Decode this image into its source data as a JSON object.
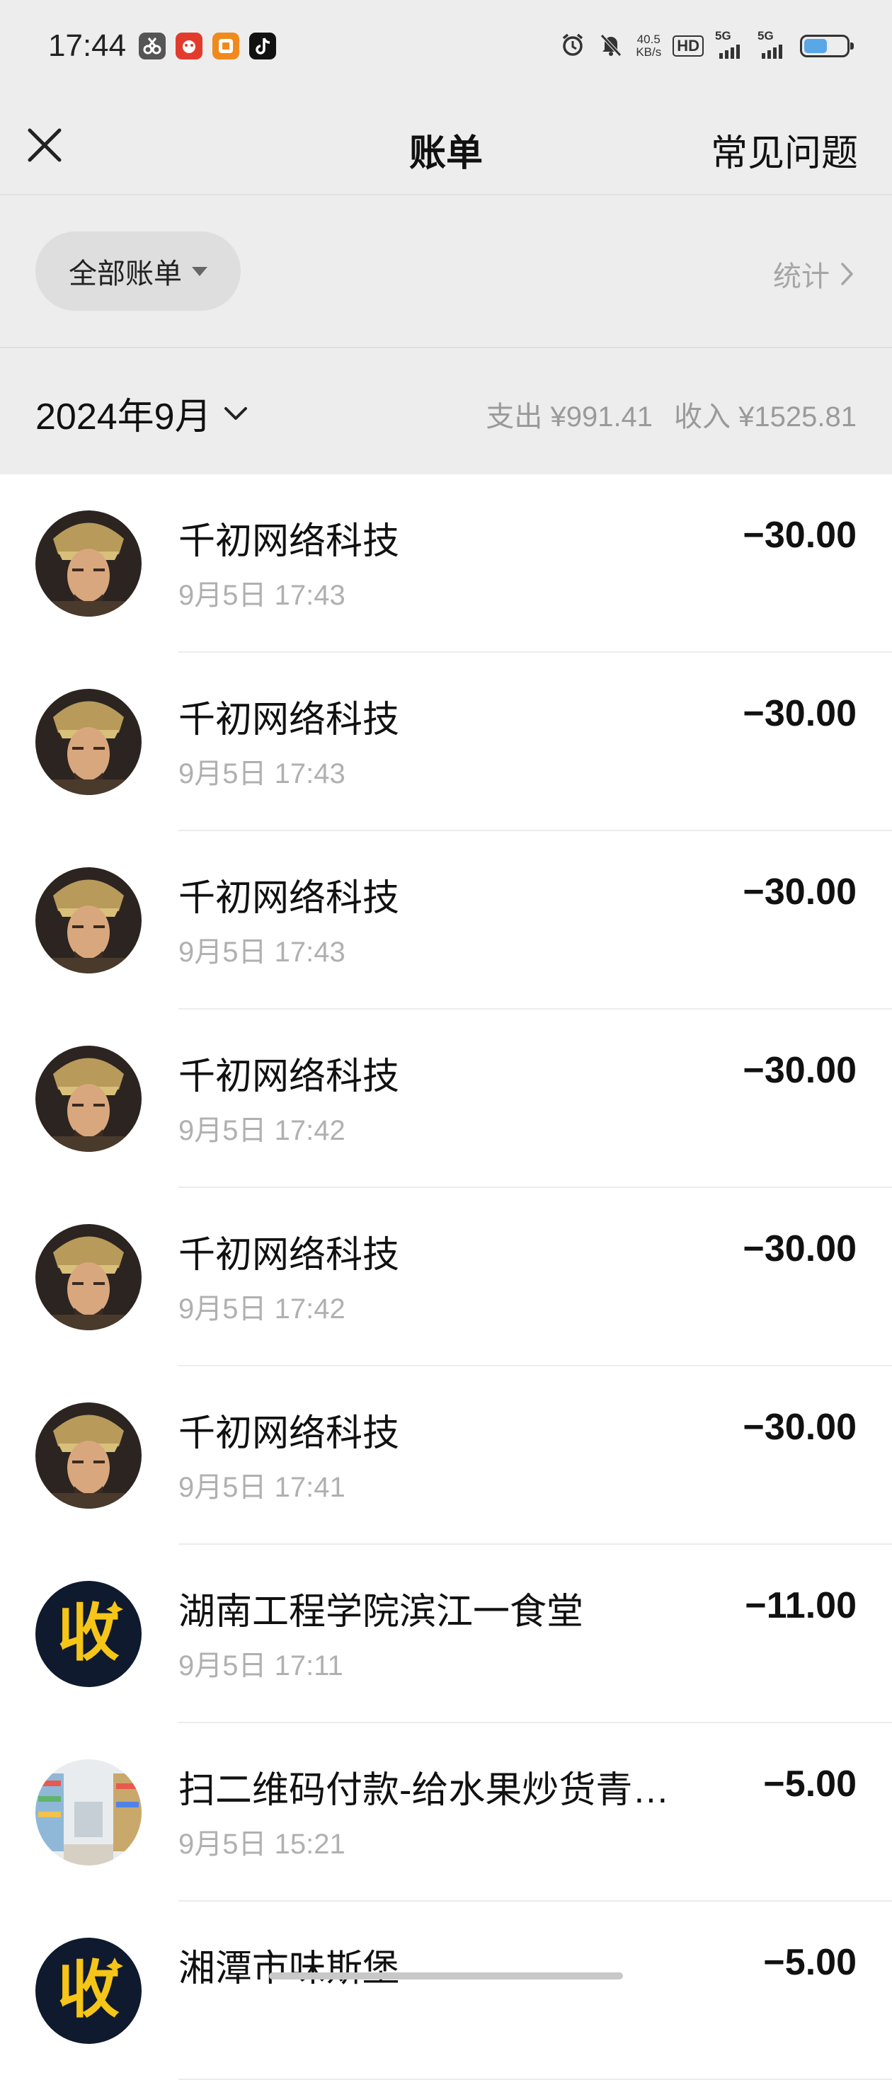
{
  "status_bar": {
    "time": "17:44",
    "net_speed_value": "40.5",
    "net_speed_unit": "KB/s",
    "hd_label": "HD",
    "signal1_label": "5G",
    "signal2_label": "5G",
    "battery_level": 0.55,
    "app_icons": [
      "scissors-app-icon",
      "red-app-icon",
      "orange-app-icon",
      "tiktok-icon"
    ]
  },
  "nav": {
    "title": "账单",
    "faq_label": "常见问题"
  },
  "filter": {
    "label": "全部账单",
    "stats_label": "统计"
  },
  "month": {
    "label": "2024年9月",
    "expense": "支出 ¥991.41",
    "income": "收入 ¥1525.81"
  },
  "transactions": [
    {
      "merchant": "千初网络科技",
      "time": "9月5日 17:43",
      "amount": "−30.00",
      "avatar": "portrait-avatar"
    },
    {
      "merchant": "千初网络科技",
      "time": "9月5日 17:43",
      "amount": "−30.00",
      "avatar": "portrait-avatar"
    },
    {
      "merchant": "千初网络科技",
      "time": "9月5日 17:43",
      "amount": "−30.00",
      "avatar": "portrait-avatar"
    },
    {
      "merchant": "千初网络科技",
      "time": "9月5日 17:42",
      "amount": "−30.00",
      "avatar": "portrait-avatar"
    },
    {
      "merchant": "千初网络科技",
      "time": "9月5日 17:42",
      "amount": "−30.00",
      "avatar": "portrait-avatar"
    },
    {
      "merchant": "千初网络科技",
      "time": "9月5日 17:41",
      "amount": "−30.00",
      "avatar": "portrait-avatar"
    },
    {
      "merchant": "湖南工程学院滨江一食堂",
      "time": "9月5日 17:11",
      "amount": "−11.00",
      "avatar": "shou-avatar",
      "avatar_text": "收"
    },
    {
      "merchant": "扫二维码付款-给水果炒货青…",
      "time": "9月5日 15:21",
      "amount": "−5.00",
      "avatar": "shop-photo-avatar"
    },
    {
      "merchant": "湘潭市味斯堡",
      "time": "",
      "amount": "−5.00",
      "avatar": "shou-avatar",
      "avatar_text": "收"
    }
  ],
  "colors": {
    "header_bg": "#ededed",
    "shou_bg": "#0f1a2e",
    "shou_fg": "#f5c518"
  }
}
